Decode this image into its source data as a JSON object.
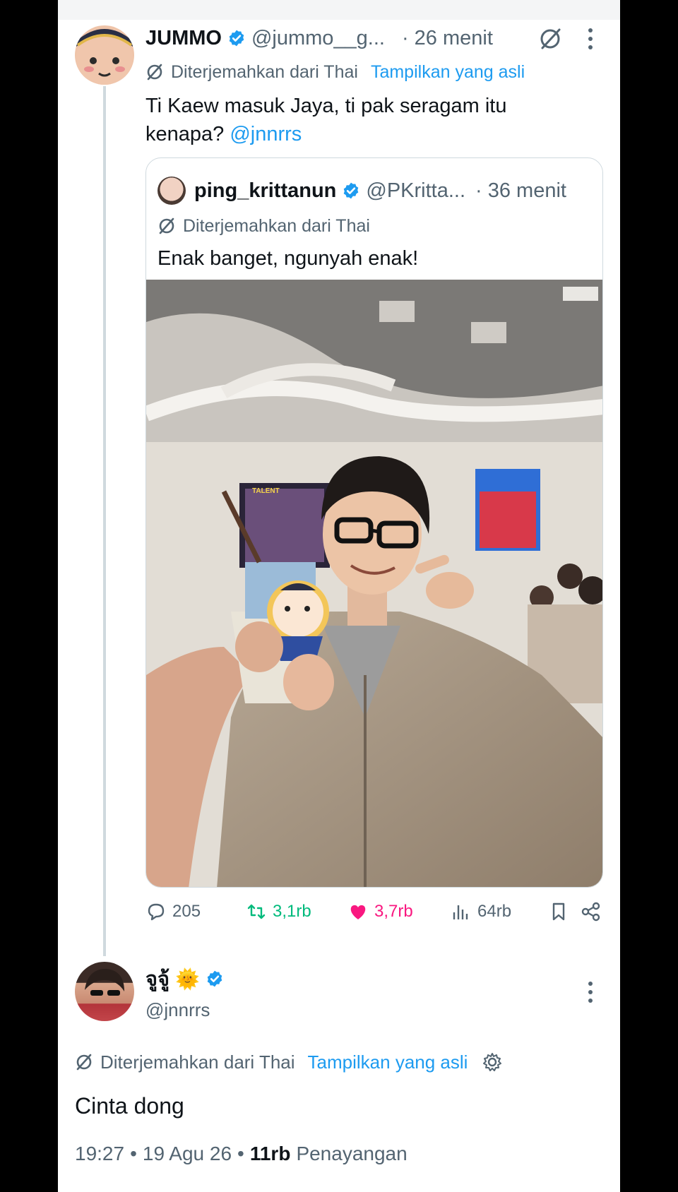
{
  "tweet": {
    "author_name": "JUMMO",
    "author_handle": "@jummo__g...",
    "time": "· 26 menit",
    "translated_note": "Diterjemahkan dari Thai",
    "show_original": "Tampilkan yang asli",
    "text_line1": "Ti Kaew masuk Jaya, ti pak seragam itu",
    "text_line2_prefix": "kenapa?",
    "mention": "@jnnrrs"
  },
  "quoted": {
    "author_name": "ping_krittanun",
    "author_handle": "@PKritta...",
    "time": "· 36 menit",
    "translated_note": "Diterjemahkan dari Thai",
    "text": "Enak banget, ngunyah enak!",
    "photo_sign": "TALENT"
  },
  "actions": {
    "replies": "205",
    "reposts": "3,1rb",
    "likes": "3,7rb",
    "views": "64rb"
  },
  "reply": {
    "author_name": "จูจู้",
    "author_emoji": "🌞",
    "author_handle": "@jnnrrs",
    "translated_note": "Diterjemahkan dari Thai",
    "show_original": "Tampilkan yang asli",
    "text": "Cinta dong",
    "time": "19:27",
    "date": "19 Agu 26",
    "views_count": "11rb",
    "views_label": "Penayangan"
  },
  "colors": {
    "accent": "#1d9bf0",
    "repost": "#00ba7c",
    "like": "#f91880",
    "muted": "#536471"
  }
}
